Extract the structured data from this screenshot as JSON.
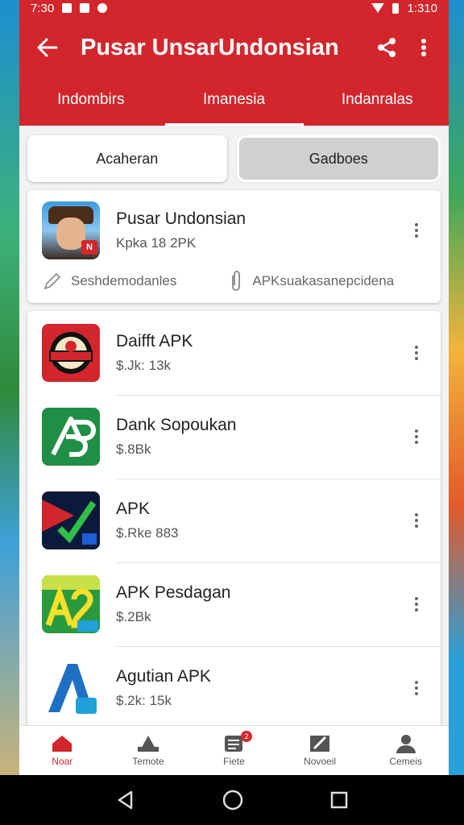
{
  "status_bar": {
    "time": "7:30",
    "right_text": "1:310"
  },
  "app_bar": {
    "title": "Pusar UnsarUndonsian"
  },
  "tabs": [
    {
      "label": "Indombirs"
    },
    {
      "label": "Imanesia"
    },
    {
      "label": "Indanralas"
    }
  ],
  "segments": [
    {
      "label": "Acaheran"
    },
    {
      "label": "Gadboes"
    }
  ],
  "featured": {
    "name": "Pusar Undonsian",
    "sub": "Kpka 18 2PK",
    "badge": "N",
    "link_left": "Seshdemodanles",
    "link_right": "APKsuakasanepcidena"
  },
  "apps": [
    {
      "name": "Daifft APK",
      "sub": "$.Jk: 13k"
    },
    {
      "name": "Dank Sopoukan",
      "sub": "$.8Bk"
    },
    {
      "name": "APK",
      "sub": "$.Rke 883"
    },
    {
      "name": "APK Pesdagan",
      "sub": "$.2Bk"
    },
    {
      "name": "Agutian APK",
      "sub": "$.2k: 15k"
    }
  ],
  "bottom_nav": [
    {
      "label": "Noar"
    },
    {
      "label": "Temote"
    },
    {
      "label": "Fiete",
      "badge": "2"
    },
    {
      "label": "Novoeil"
    },
    {
      "label": "Cemeis"
    }
  ],
  "colors": {
    "primary": "#d3262c",
    "background": "#f2f2f2"
  }
}
